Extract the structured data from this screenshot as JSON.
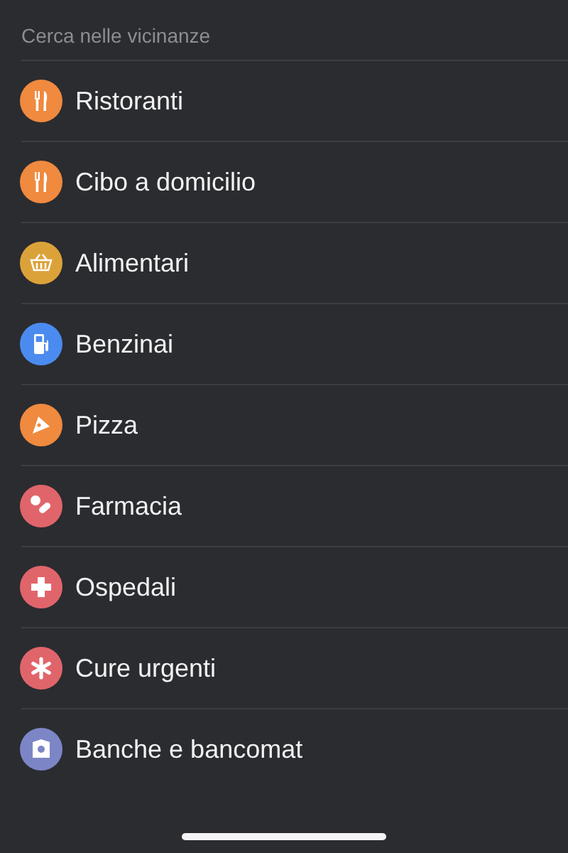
{
  "section_title": "Cerca nelle vicinanze",
  "items": [
    {
      "label": "Ristoranti",
      "kind": "food",
      "color": "#ef8a3f"
    },
    {
      "label": "Cibo a domicilio",
      "kind": "food",
      "color": "#ef8a3f"
    },
    {
      "label": "Alimentari",
      "kind": "basket",
      "color": "#dca23a"
    },
    {
      "label": "Benzinai",
      "kind": "fuel",
      "color": "#4b8bef"
    },
    {
      "label": "Pizza",
      "kind": "pizza",
      "color": "#ef8a3f"
    },
    {
      "label": "Farmacia",
      "kind": "pills",
      "color": "#e0656b"
    },
    {
      "label": "Ospedali",
      "kind": "cross",
      "color": "#e0656b"
    },
    {
      "label": "Cure urgenti",
      "kind": "asterisk",
      "color": "#e0656b"
    },
    {
      "label": "Banche e bancomat",
      "kind": "bank",
      "color": "#7c86c6"
    }
  ]
}
